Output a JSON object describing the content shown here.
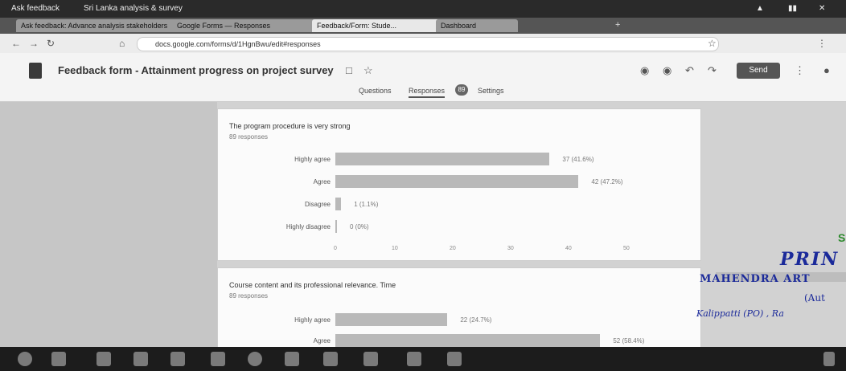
{
  "os": {
    "app": "Ask feedback",
    "doc": "Sri Lanka analysis & survey"
  },
  "tabs": [
    {
      "label": "Ask feedback: Advance analysis stakeholders",
      "x": 20,
      "w": 190
    },
    {
      "label": "Google Forms — Responses",
      "x": 214,
      "w": 170
    },
    {
      "label": "Feedback/Form: Stude...",
      "x": 388,
      "w": 150
    },
    {
      "label": "Dashboard",
      "x": 542,
      "w": 90
    }
  ],
  "address": {
    "url": "docs.google.com/forms/d/1HgnBwu/edit#responses"
  },
  "form_header": {
    "title": "Feedback form - Attainment progress on project survey",
    "send": "Send",
    "tab_questions": "Questions",
    "tab_responses": "Responses",
    "tab_settings": "Settings",
    "responses_count": "89"
  },
  "question_1": {
    "title": "The program procedure is very strong",
    "subtitle": "89 responses"
  },
  "question_2": {
    "title": "Course content and its professional relevance. Time",
    "subtitle": "89 responses"
  },
  "stamp": {
    "line0": "S",
    "line1": "PRIN",
    "line2": "MAHENDRA ART",
    "line3": "(Aut",
    "line4": "Kalippatti (PO) , Ra"
  },
  "chart_data": [
    {
      "type": "bar",
      "title": "The program procedure is very strong",
      "categories": [
        "Highly agree",
        "Agree",
        "Disagree",
        "Highly disagree"
      ],
      "values": [
        37,
        42,
        1,
        0
      ],
      "value_labels": [
        "37 (41.6%)",
        "42 (47.2%)",
        "1 (1.1%)",
        "0 (0%)"
      ],
      "xlim": [
        0,
        50
      ],
      "xticks": [
        "0",
        "10",
        "20",
        "30",
        "40",
        "50"
      ],
      "orientation": "horizontal"
    },
    {
      "type": "bar",
      "title": "Course content and its professional relevance. Time",
      "categories": [
        "Highly agree",
        "Agree"
      ],
      "values": [
        22,
        52
      ],
      "value_labels": [
        "22 (24.7%)",
        "52 (58.4%)"
      ],
      "xlim": [
        0,
        60
      ],
      "orientation": "horizontal"
    }
  ]
}
